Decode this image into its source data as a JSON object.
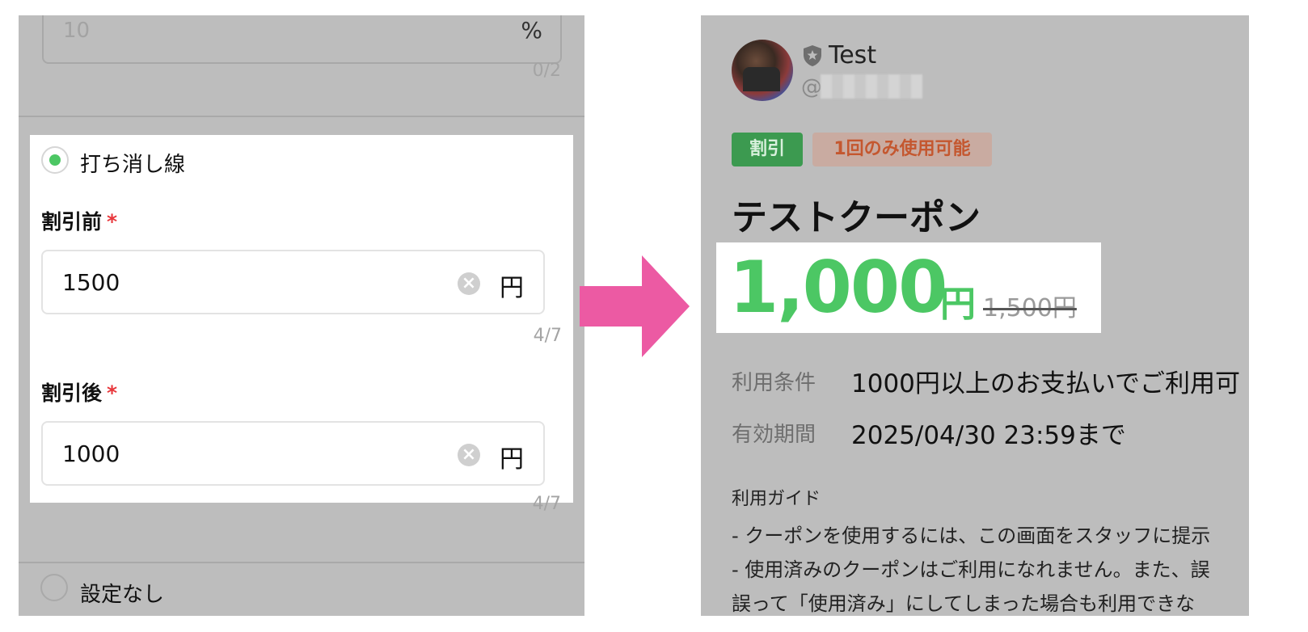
{
  "left": {
    "top_field": {
      "value": "10",
      "unit": "%",
      "counter": "0/2"
    },
    "strike_option": {
      "label": "打ち消し線",
      "selected": true
    },
    "before_field": {
      "label": "割引前",
      "required_mark": "*",
      "value": "1500",
      "unit": "円",
      "counter": "4/7"
    },
    "after_field": {
      "label": "割引後",
      "required_mark": "*",
      "value": "1000",
      "unit": "円",
      "counter": "4/7"
    },
    "none_option": {
      "label": "設定なし",
      "selected": false
    }
  },
  "right": {
    "account": {
      "name": "Test",
      "handle_prefix": "@"
    },
    "badges": {
      "discount": "割引",
      "once": "1回のみ使用可能"
    },
    "coupon_title": "テストクーポン",
    "price": {
      "main": "1,000",
      "unit": "円",
      "before": "1,500円"
    },
    "conditions": {
      "label": "利用条件",
      "value": "1000円以上のお支払いでご利用可"
    },
    "validity": {
      "label": "有効期間",
      "value": "2025/04/30 23:59まで"
    },
    "guide": {
      "title": "利用ガイド",
      "lines": [
        "- クーポンを使用するには、この画面をスタッフに提示",
        "- 使用済みのクーポンはご利用になれません。また、誤",
        "誤って「使用済み」にしてしまった場合も利用できな"
      ]
    }
  },
  "colors": {
    "accent_green": "#4cc764",
    "arrow_pink": "#ec5aa3",
    "required_red": "#e8363b",
    "badge_green": "#3c9a50",
    "badge_orange_text": "#c4572f"
  },
  "icons": {
    "clear": "clear-icon",
    "shield": "shield-icon",
    "arrow": "right-arrow-icon"
  }
}
